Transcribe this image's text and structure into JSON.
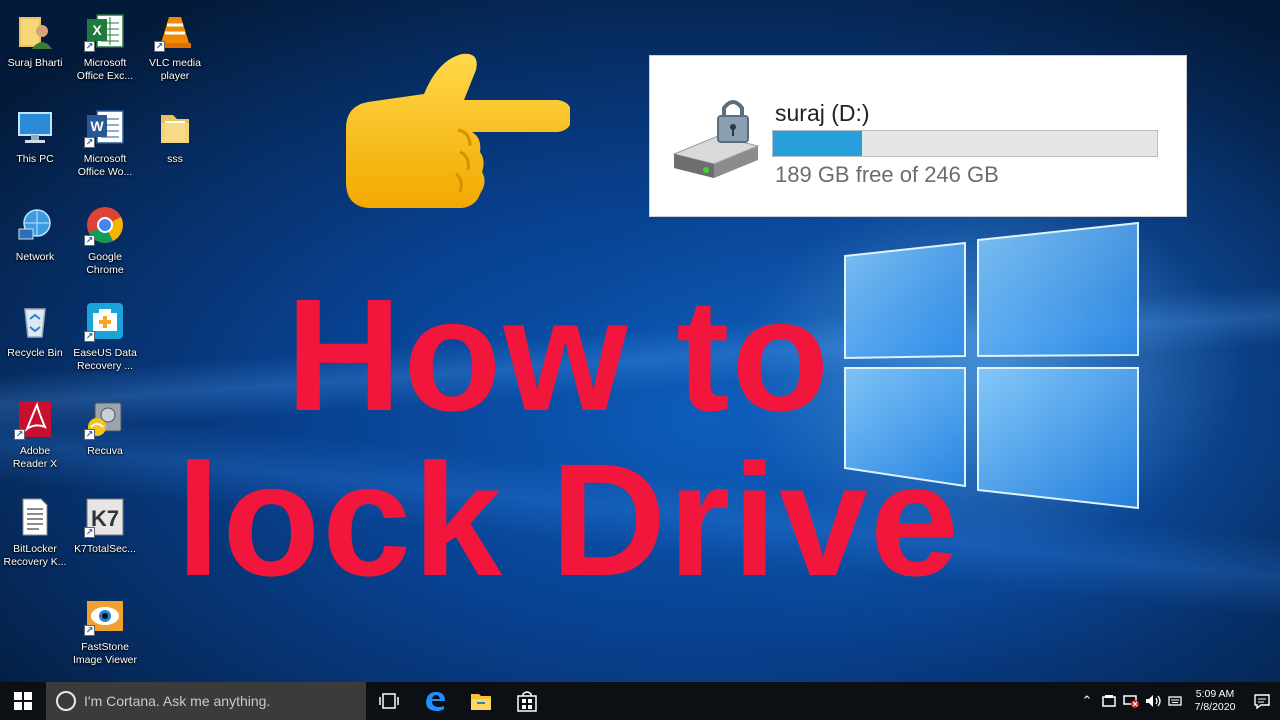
{
  "desktop_icons": [
    {
      "label": "Suraj Bharti",
      "icon": "user-folder-icon"
    },
    {
      "label": "Microsoft\nOffice Exc...",
      "icon": "excel-icon"
    },
    {
      "label": "VLC media\nplayer",
      "icon": "vlc-icon"
    },
    {
      "label": "This PC",
      "icon": "this-pc-icon"
    },
    {
      "label": "Microsoft\nOffice Wo...",
      "icon": "word-icon"
    },
    {
      "label": "sss",
      "icon": "folder-icon"
    },
    {
      "label": "Network",
      "icon": "network-icon"
    },
    {
      "label": "Google\nChrome",
      "icon": "chrome-icon"
    },
    {
      "label": "Recycle Bin",
      "icon": "recycle-bin-icon"
    },
    {
      "label": "EaseUS Data\nRecovery ...",
      "icon": "easeus-icon"
    },
    {
      "label": "Adobe\nReader X",
      "icon": "adobe-reader-icon"
    },
    {
      "label": "Recuva",
      "icon": "recuva-icon"
    },
    {
      "label": "BitLocker\nRecovery K...",
      "icon": "text-document-icon"
    },
    {
      "label": "K7TotalSec...",
      "icon": "k7-icon"
    },
    {
      "label": "FastStone\nImage Viewer",
      "icon": "faststone-icon"
    }
  ],
  "drive": {
    "name": "suraj (D:)",
    "free_text": "189 GB free of 246 GB",
    "used_fraction": 0.232,
    "bar_color": "#26a0da"
  },
  "headline": {
    "line1": "How to",
    "line2": "lock Drive",
    "color": "#f2153c"
  },
  "taskbar": {
    "search_placeholder": "I'm Cortana. Ask me anything.",
    "clock_time": "5:09 AM",
    "clock_date": "7/8/2020"
  }
}
